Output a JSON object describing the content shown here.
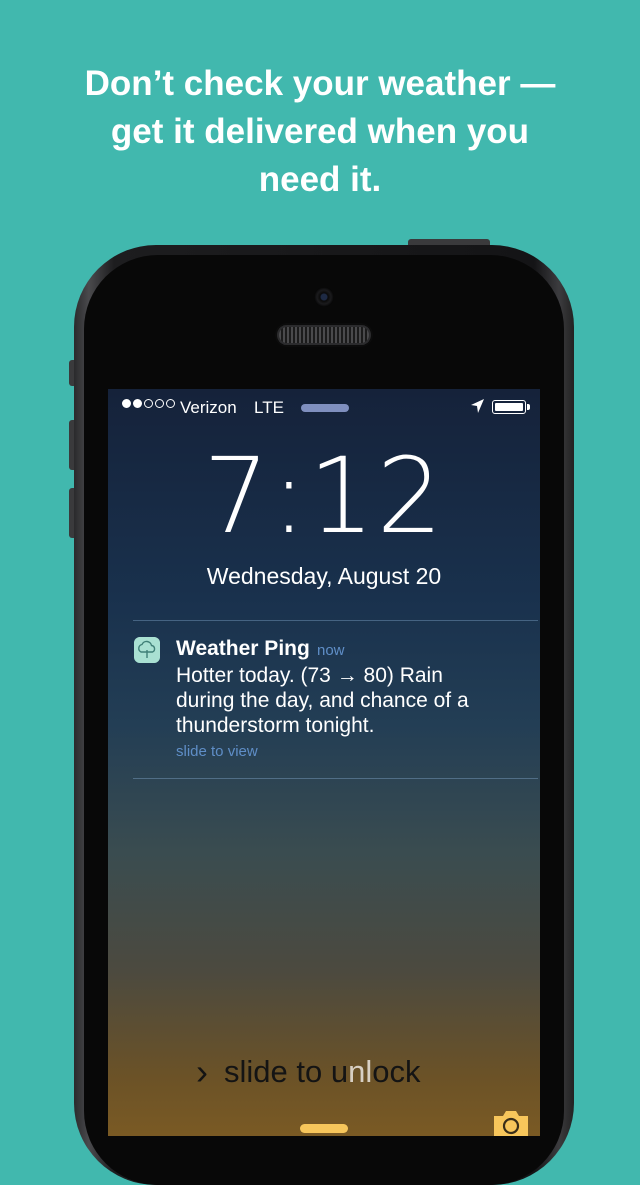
{
  "headline": {
    "line1": "Don’t check your weather —",
    "line2": "get it delivered when you",
    "line3": "need it."
  },
  "status_bar": {
    "signal_dots_filled": 2,
    "signal_dots_total": 5,
    "carrier": "Verizon",
    "network": "LTE",
    "location_icon": "location-arrow-icon",
    "battery_level": 1.0
  },
  "lock_screen": {
    "time": "7:12",
    "date": "Wednesday, August 20",
    "slide_to_unlock_lead": "slide to u",
    "slide_to_unlock_shine": "nl",
    "slide_to_unlock_tail": "ock"
  },
  "notification": {
    "app_icon": "cloud-rain-icon",
    "app_name": "Weather Ping",
    "time": "now",
    "body_line1": "Hotter today. (73 → 80) Rain",
    "body_line2": "during the day, and chance of a",
    "body_line3": "thunderstorm tonight.",
    "action": "slide to view"
  },
  "colors": {
    "background": "#41b8ae",
    "notification_accent": "#5f8ec7",
    "grabber": "#f7c65b"
  }
}
